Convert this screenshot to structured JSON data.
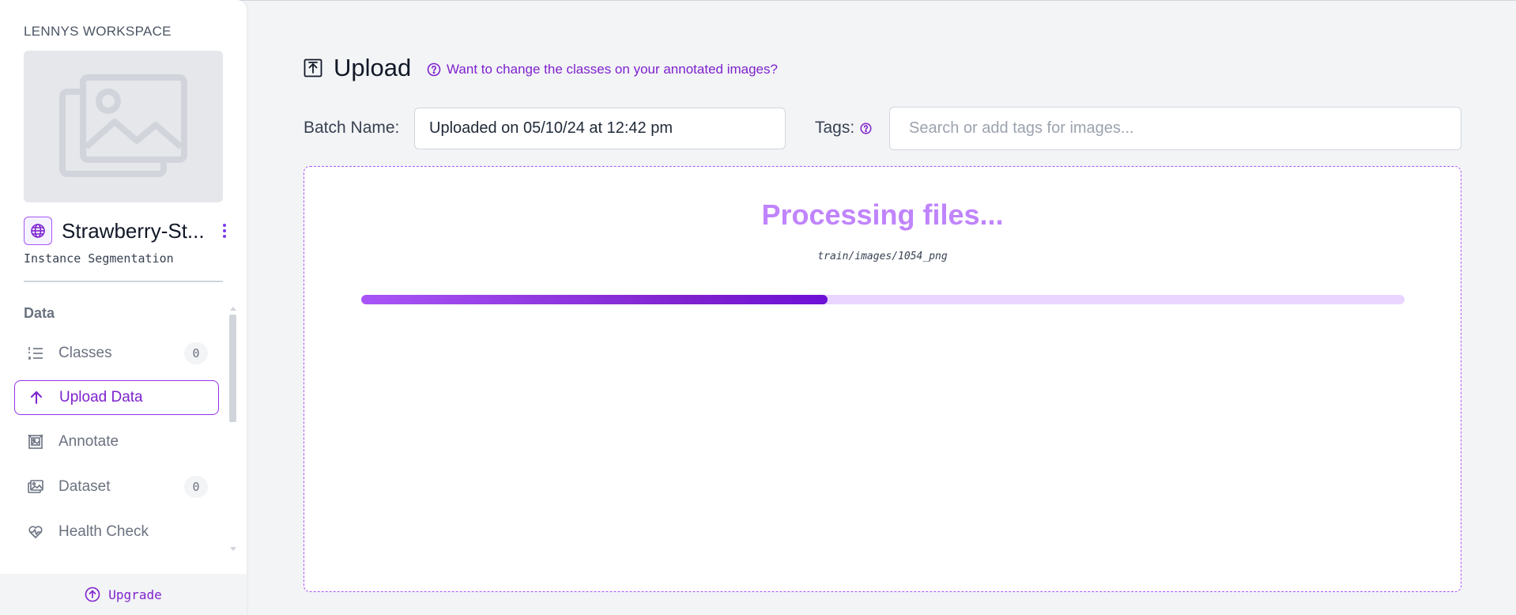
{
  "sidebar": {
    "workspace_name": "LENNYS WORKSPACE",
    "project": {
      "name": "Strawberry-St...",
      "type": "Instance Segmentation"
    },
    "section_label": "Data",
    "items": [
      {
        "label": "Classes",
        "badge": "0",
        "icon": "list-icon"
      },
      {
        "label": "Upload Data",
        "icon": "arrow-up-icon",
        "active": true
      },
      {
        "label": "Annotate",
        "icon": "annotate-icon"
      },
      {
        "label": "Dataset",
        "badge": "0",
        "icon": "images-icon"
      },
      {
        "label": "Health Check",
        "icon": "heart-pulse-icon"
      }
    ],
    "upgrade_label": "Upgrade"
  },
  "main": {
    "title": "Upload",
    "help_link": "Want to change the classes on your annotated images?",
    "batch_name_label": "Batch Name:",
    "batch_name_value": "Uploaded on 05/10/24 at 12:42 pm",
    "tags_label": "Tags:",
    "tags_placeholder": "Search or add tags for images...",
    "status_text": "Processing files...",
    "current_file": "train/images/1054_png",
    "progress_fraction": 0.447
  },
  "colors": {
    "accent": "#7e22ce",
    "accent_light": "#c084fc",
    "track": "#e9d5ff"
  }
}
